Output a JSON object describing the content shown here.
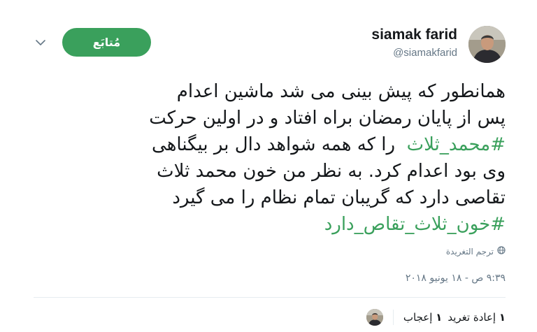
{
  "user": {
    "display_name": "siamak farid",
    "handle": "@siamakfarid"
  },
  "follow_button": {
    "label": "مُتابَع"
  },
  "tweet": {
    "lines": [
      [
        {
          "text": "همانطور که پیش بینی می شد ماشین اعدام",
          "hashtag": false
        }
      ],
      [
        {
          "text": "پس از پایان رمضان براه افتاد و در اولین حرکت",
          "hashtag": false
        }
      ],
      [
        {
          "text": "#محمد_ثلاث",
          "hashtag": true
        },
        {
          "text": "  را که همه شواهد دال بر بیگناهی",
          "hashtag": false
        }
      ],
      [
        {
          "text": "وی بود اعدام کرد. به نظر من خون محمد ثلاث",
          "hashtag": false
        }
      ],
      [
        {
          "text": "تقاصی دارد که گریبان تمام نظام را می گیرد",
          "hashtag": false
        }
      ],
      [
        {
          "text": "#خون_ثلاث_تقاص_دارد",
          "hashtag": true
        }
      ]
    ],
    "translate_label": "ترجم التغريدة",
    "timestamp": "٩:٣٩ ص - ١٨ يونيو ٢٠١٨",
    "retweets": {
      "count": "١",
      "label": "إعادة تغريد"
    },
    "likes": {
      "count": "١",
      "label": "إعجاب"
    }
  },
  "colors": {
    "accent": "#3aa05c",
    "secondary_text": "#657786",
    "primary_text": "#14171a"
  },
  "icons": {
    "menu": "chevron-down-icon",
    "translate": "globe-icon"
  }
}
